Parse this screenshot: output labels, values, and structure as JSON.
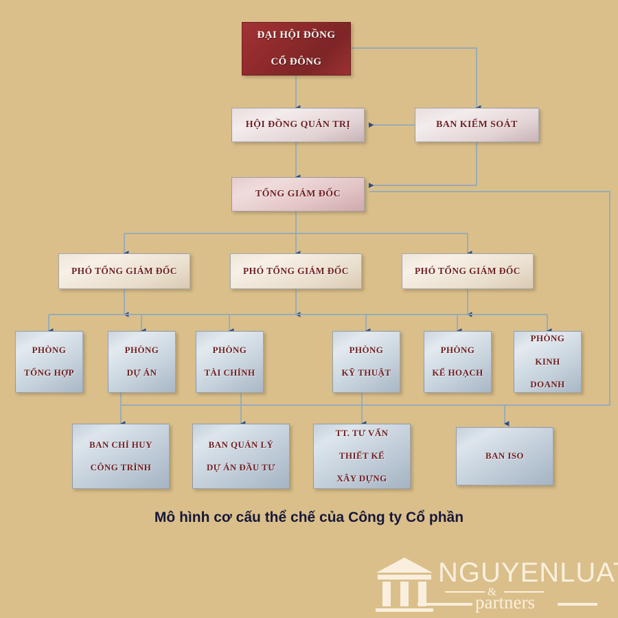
{
  "background_color": "#dabf8a",
  "caption": "Mô hình cơ cấu thể chế của Công ty Cổ phần",
  "colors": {
    "level1_box": "#8e2a2c",
    "level1_text": "#fdf6f1",
    "box_text": "#6e1f22",
    "connector": "#8fa8bd",
    "arrowhead": "#2a4f86",
    "caption_text": "#17173a",
    "watermark_text": "#fdf4e6"
  },
  "nodes": {
    "shareholders_meeting": {
      "line1": "ĐẠI HỘI ĐỒNG",
      "line2": "CỔ ĐÔNG"
    },
    "board_of_management": {
      "line1": "HỘI ĐỒNG QUẢN TRỊ"
    },
    "supervisory_board": {
      "line1": "BAN KIỂM SOÁT"
    },
    "general_director": {
      "line1": "TỔNG GIÁM ĐỐC"
    },
    "deputy_director_1": {
      "line1": "PHÓ TỔNG GIÁM ĐỐC"
    },
    "deputy_director_2": {
      "line1": "PHÓ TỔNG GIÁM ĐỐC"
    },
    "deputy_director_3": {
      "line1": "PHÓ TỔNG GIÁM ĐỐC"
    },
    "dept_general": {
      "line1": "PHÒNG",
      "line2": "TỔNG HỢP"
    },
    "dept_project": {
      "line1": "PHÒNG",
      "line2": "DỰ ÁN"
    },
    "dept_finance": {
      "line1": "PHÒNG",
      "line2": "TÀI CHÍNH"
    },
    "dept_technical": {
      "line1": "PHÒNG",
      "line2": "KỸ THUẬT"
    },
    "dept_planning": {
      "line1": "PHÒNG",
      "line2": "KẾ HOẠCH"
    },
    "dept_business": {
      "line1": "PHÒNG",
      "line2": "KINH",
      "line3": "DOANH"
    },
    "construction_command": {
      "line1": "BAN CHỈ HUY",
      "line2": "CÔNG TRÌNH"
    },
    "investment_project_mgmt": {
      "line1": "BAN QUẢN LÝ",
      "line2": "DỰ ÁN ĐẦU TƯ"
    },
    "design_consulting_center": {
      "line1": "TT. TƯ VẤN",
      "line2": "THIẾT KẾ",
      "line3": "XÂY DỰNG"
    },
    "iso_board": {
      "line1": "BAN ISO"
    }
  },
  "watermark": {
    "name": "NGUYENLUAT",
    "ampersand": "&",
    "subtitle": "partners",
    "icon": "classical-column-icon"
  }
}
